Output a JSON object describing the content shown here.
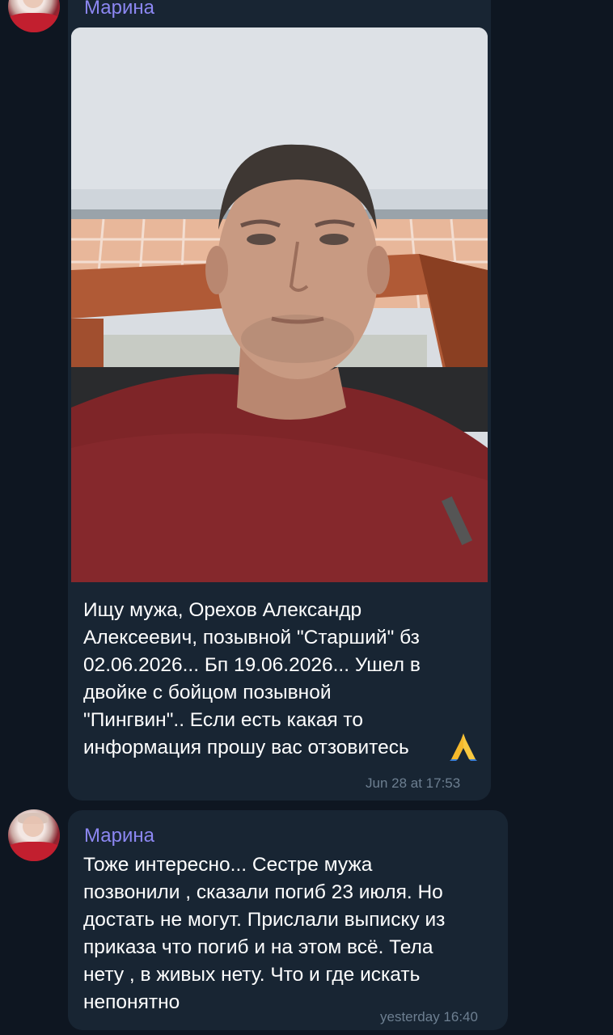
{
  "messages": [
    {
      "sender": "Марина",
      "text": "Ищу мужа, Орехов Александр\nАлексеевич, позывной \"Старший\" бз\n02.06.2026... Бп 19.06.2026... Ушел в\nдвойке с бойцом позывной\n\"Пингвин\".. Если есть какая то\nинформация прошу вас отзовитесь",
      "emoji": "🙏",
      "time": "Jun 28 at 17:53",
      "has_photo": true
    },
    {
      "sender": "Марина",
      "text": "Тоже интересно... Сестре мужа\nпозвонили , сказали погиб 23 июля. Но\nдостать не могут. Прислали выписку из\nприказа что погиб и на этом всё. Тела\nнету , в живых нету. Что и где искать\nнепонятно",
      "time": "yesterday 16:40"
    }
  ],
  "colors": {
    "background": "#0e1621",
    "bubble": "#182533",
    "sender": "#8c87f2",
    "time": "#6d7f91"
  }
}
